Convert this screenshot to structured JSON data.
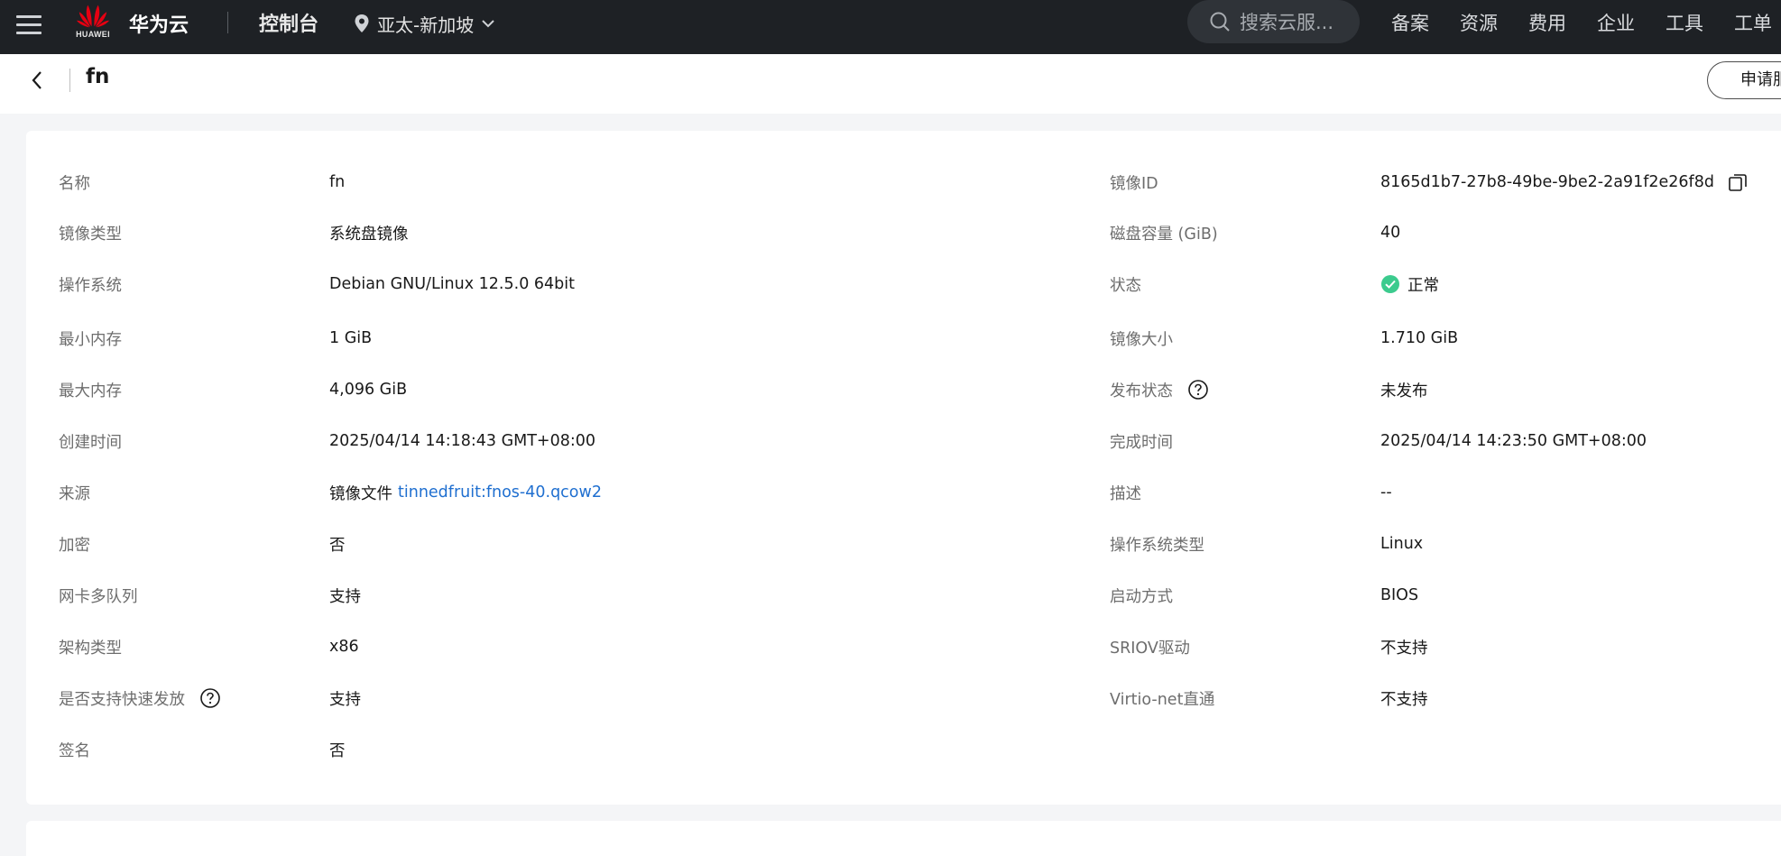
{
  "topbar": {
    "logo_text": "HUAWEI",
    "brand": "华为云",
    "console": "控制台",
    "region": "亚太-新加坡",
    "search_placeholder": "搜索云服...",
    "nav": [
      "备案",
      "资源",
      "费用",
      "企业",
      "工具",
      "工单"
    ]
  },
  "subheader": {
    "title": "fn",
    "apply_label": "申请服务"
  },
  "details": {
    "name_label": "名称",
    "name_value": "fn",
    "type_label": "镜像类型",
    "type_value": "系统盘镜像",
    "os_label": "操作系统",
    "os_value": "Debian GNU/Linux 12.5.0 64bit",
    "min_mem_label": "最小内存",
    "min_mem_value": "1 GiB",
    "max_mem_label": "最大内存",
    "max_mem_value": "4,096 GiB",
    "created_label": "创建时间",
    "created_value": "2025/04/14 14:18:43 GMT+08:00",
    "source_label": "来源",
    "source_prefix": "镜像文件",
    "source_link": "tinnedfruit:fnos-40.qcow2",
    "encrypt_label": "加密",
    "encrypt_value": "否",
    "nic_label": "网卡多队列",
    "nic_value": "支持",
    "arch_label": "架构类型",
    "arch_value": "x86",
    "fast_label": "是否支持快速发放",
    "fast_value": "支持",
    "sign_label": "签名",
    "sign_value": "否",
    "id_label": "镜像ID",
    "id_value": "8165d1b7-27b8-49be-9be2-2a91f2e26f8d",
    "disk_label": "磁盘容量 (GiB)",
    "disk_value": "40",
    "status_label": "状态",
    "status_value": "正常",
    "size_label": "镜像大小",
    "size_value": "1.710 GiB",
    "publish_label": "发布状态",
    "publish_value": "未发布",
    "done_label": "完成时间",
    "done_value": "2025/04/14 14:23:50 GMT+08:00",
    "desc_label": "描述",
    "desc_value": "--",
    "ostype_label": "操作系统类型",
    "ostype_value": "Linux",
    "boot_label": "启动方式",
    "boot_value": "BIOS",
    "sriov_label": "SRIOV驱动",
    "sriov_value": "不支持",
    "virtio_label": "Virtio-net直通",
    "virtio_value": "不支持"
  },
  "colors": {
    "topbar_bg": "#1e2125",
    "link": "#1f6fd0",
    "status_ok": "#3ccb8e",
    "huawei_red": "#e60012"
  }
}
